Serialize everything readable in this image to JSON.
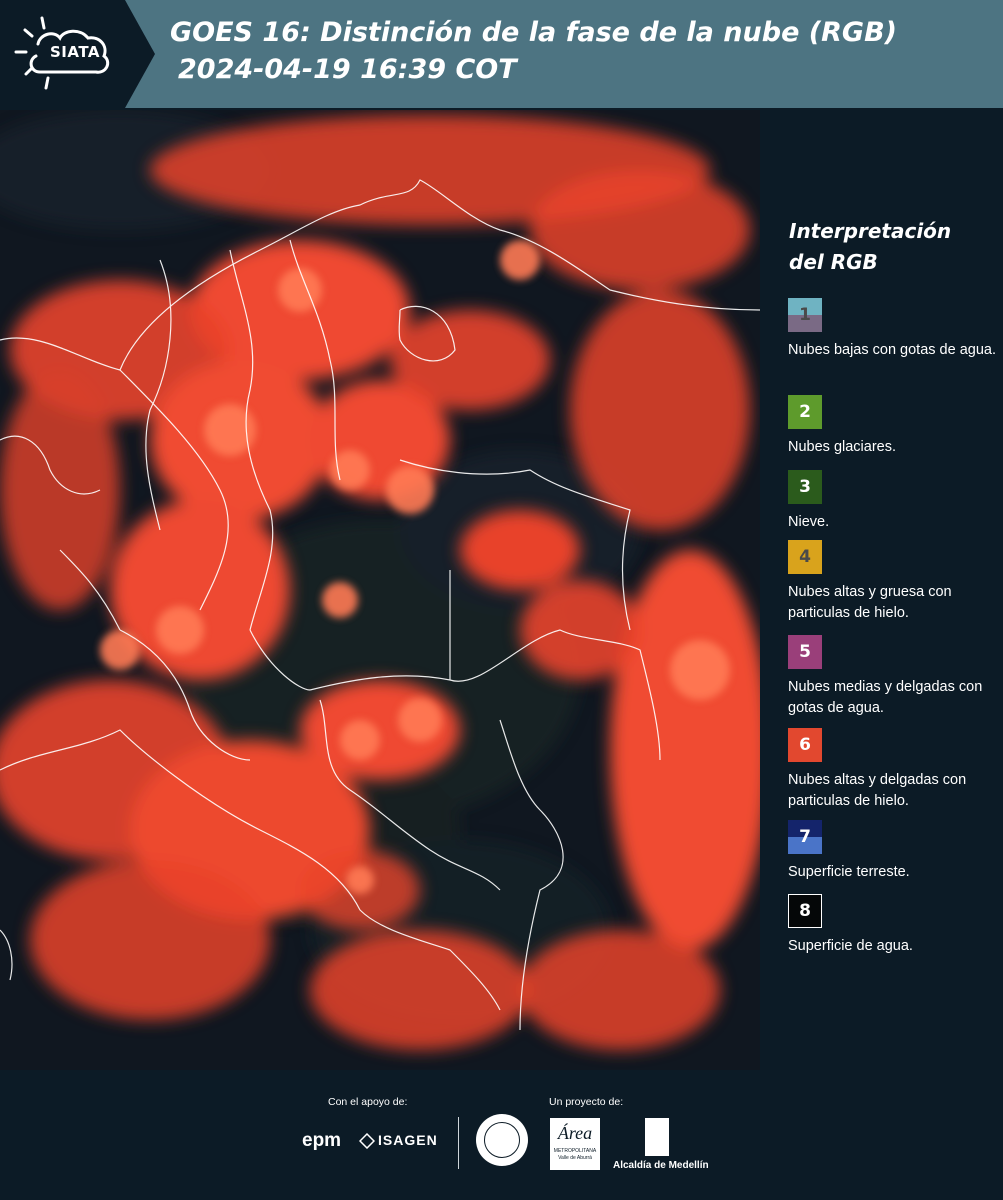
{
  "header": {
    "brand": "SIATA",
    "title_line1": "GOES 16: Distinción de la fase de la nube (RGB)",
    "title_line2": "2024-04-19 16:39 COT",
    "color": "#4d7482"
  },
  "legend": {
    "title": "Interpretación del RGB",
    "items": [
      {
        "num": "1",
        "label": "Nubes bajas con gotas de agua.",
        "colors": [
          "#6fb3c2",
          "#7a6a85"
        ],
        "num_color": "#4a4a4a"
      },
      {
        "num": "2",
        "label": "Nubes glaciares.",
        "colors": [
          "#5e9b2c"
        ],
        "num_color": "#ffffff"
      },
      {
        "num": "3",
        "label": "Nieve.",
        "colors": [
          "#2b5b1c"
        ],
        "num_color": "#ffffff"
      },
      {
        "num": "4",
        "label": "Nubes altas y gruesa con particulas de hielo.",
        "colors": [
          "#d9a31c"
        ],
        "num_color": "#4a4a4a"
      },
      {
        "num": "5",
        "label": "Nubes medias y delgadas con gotas de agua.",
        "colors": [
          "#9a3f7a"
        ],
        "num_color": "#ffffff"
      },
      {
        "num": "6",
        "label": "Nubes altas y delgadas con particulas de hielo.",
        "colors": [
          "#e2482f"
        ],
        "num_color": "#ffffff"
      },
      {
        "num": "7",
        "label": "Superficie terreste.",
        "colors": [
          "#14246b",
          "#4a74c8"
        ],
        "num_color": "#ffffff"
      },
      {
        "num": "8",
        "label": "Superficie de agua.",
        "colors": [
          "#050708"
        ],
        "num_color": "#ffffff"
      }
    ]
  },
  "footer": {
    "support_label": "Con el apoyo de:",
    "project_label": "Un proyecto de:",
    "partner1": "epm",
    "partner2": "ISAGEN",
    "partner3": "Área",
    "partner3_sub": "METROPOLITANA Valle de Aburrá",
    "partner4": "Alcaldía de Medellín"
  },
  "map": {
    "cloud_color": "#f2472e",
    "background_color": "#111822",
    "border_color": "#ffffff"
  }
}
